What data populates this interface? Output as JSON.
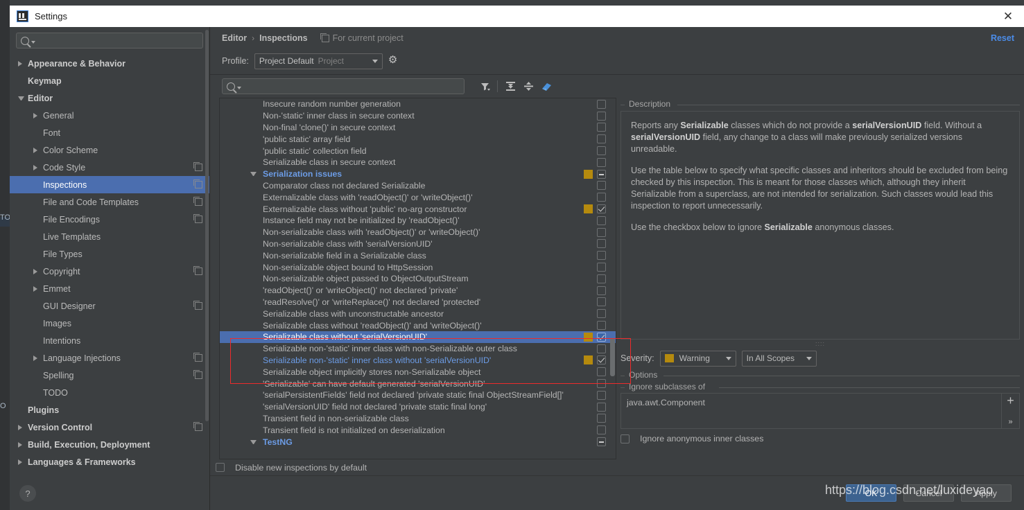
{
  "window": {
    "title": "Settings",
    "close_label": "✕",
    "logo": "intellij-idea-logo"
  },
  "sidebar": {
    "search_placeholder": "",
    "search_value": "",
    "help_label": "?",
    "items": [
      {
        "label": "Appearance & Behavior",
        "arrow": "right",
        "indent": 0,
        "bold": true,
        "copy": false,
        "selected": false
      },
      {
        "label": "Keymap",
        "arrow": "none",
        "indent": 0,
        "bold": true,
        "copy": false,
        "selected": false
      },
      {
        "label": "Editor",
        "arrow": "down",
        "indent": 0,
        "bold": true,
        "copy": false,
        "selected": false
      },
      {
        "label": "General",
        "arrow": "right",
        "indent": 1,
        "bold": false,
        "copy": false,
        "selected": false
      },
      {
        "label": "Font",
        "arrow": "none",
        "indent": 1,
        "bold": false,
        "copy": false,
        "selected": false
      },
      {
        "label": "Color Scheme",
        "arrow": "right",
        "indent": 1,
        "bold": false,
        "copy": false,
        "selected": false
      },
      {
        "label": "Code Style",
        "arrow": "right",
        "indent": 1,
        "bold": false,
        "copy": true,
        "selected": false
      },
      {
        "label": "Inspections",
        "arrow": "none",
        "indent": 1,
        "bold": false,
        "copy": true,
        "selected": true
      },
      {
        "label": "File and Code Templates",
        "arrow": "none",
        "indent": 1,
        "bold": false,
        "copy": true,
        "selected": false
      },
      {
        "label": "File Encodings",
        "arrow": "none",
        "indent": 1,
        "bold": false,
        "copy": true,
        "selected": false
      },
      {
        "label": "Live Templates",
        "arrow": "none",
        "indent": 1,
        "bold": false,
        "copy": false,
        "selected": false
      },
      {
        "label": "File Types",
        "arrow": "none",
        "indent": 1,
        "bold": false,
        "copy": false,
        "selected": false
      },
      {
        "label": "Copyright",
        "arrow": "right",
        "indent": 1,
        "bold": false,
        "copy": true,
        "selected": false
      },
      {
        "label": "Emmet",
        "arrow": "right",
        "indent": 1,
        "bold": false,
        "copy": false,
        "selected": false
      },
      {
        "label": "GUI Designer",
        "arrow": "none",
        "indent": 1,
        "bold": false,
        "copy": true,
        "selected": false
      },
      {
        "label": "Images",
        "arrow": "none",
        "indent": 1,
        "bold": false,
        "copy": false,
        "selected": false
      },
      {
        "label": "Intentions",
        "arrow": "none",
        "indent": 1,
        "bold": false,
        "copy": false,
        "selected": false
      },
      {
        "label": "Language Injections",
        "arrow": "right",
        "indent": 1,
        "bold": false,
        "copy": true,
        "selected": false
      },
      {
        "label": "Spelling",
        "arrow": "none",
        "indent": 1,
        "bold": false,
        "copy": true,
        "selected": false
      },
      {
        "label": "TODO",
        "arrow": "none",
        "indent": 1,
        "bold": false,
        "copy": false,
        "selected": false
      },
      {
        "label": "Plugins",
        "arrow": "none",
        "indent": 0,
        "bold": true,
        "copy": false,
        "selected": false
      },
      {
        "label": "Version Control",
        "arrow": "right",
        "indent": 0,
        "bold": true,
        "copy": true,
        "selected": false
      },
      {
        "label": "Build, Execution, Deployment",
        "arrow": "right",
        "indent": 0,
        "bold": true,
        "copy": false,
        "selected": false
      },
      {
        "label": "Languages & Frameworks",
        "arrow": "right",
        "indent": 0,
        "bold": true,
        "copy": false,
        "selected": false
      }
    ]
  },
  "header": {
    "breadcrumb_root": "Editor",
    "breadcrumb_sep": "›",
    "breadcrumb_current": "Inspections",
    "for_current_project": "For current project",
    "reset_label": "Reset"
  },
  "profile": {
    "label": "Profile:",
    "value": "Project Default",
    "scope": "Project",
    "gear_icon": "gear-icon"
  },
  "toolbar": {
    "search_value": "",
    "search_placeholder": "",
    "filter_icon": "filter-funnel-icon",
    "expand_icon": "expand-all-icon",
    "collapse_icon": "collapse-all-icon",
    "reset_to_empty_icon": "eraser-icon"
  },
  "inspections": {
    "rows": [
      {
        "label": "Insecure random number generation",
        "group": false,
        "severity": null,
        "check": "off",
        "selected": false,
        "blue": false
      },
      {
        "label": "Non-'static' inner class in secure context",
        "group": false,
        "severity": null,
        "check": "off",
        "selected": false,
        "blue": false
      },
      {
        "label": "Non-final 'clone()' in secure context",
        "group": false,
        "severity": null,
        "check": "off",
        "selected": false,
        "blue": false
      },
      {
        "label": "'public static' array field",
        "group": false,
        "severity": null,
        "check": "off",
        "selected": false,
        "blue": false
      },
      {
        "label": "'public static' collection field",
        "group": false,
        "severity": null,
        "check": "off",
        "selected": false,
        "blue": false
      },
      {
        "label": "Serializable class in secure context",
        "group": false,
        "severity": null,
        "check": "off",
        "selected": false,
        "blue": false
      },
      {
        "label": "Serialization issues",
        "group": true,
        "severity": "#b58a0e",
        "check": "tri",
        "selected": false,
        "blue": false
      },
      {
        "label": "Comparator class not declared Serializable",
        "group": false,
        "severity": null,
        "check": "off",
        "selected": false,
        "blue": false
      },
      {
        "label": "Externalizable class with 'readObject()' or 'writeObject()'",
        "group": false,
        "severity": null,
        "check": "off",
        "selected": false,
        "blue": false
      },
      {
        "label": "Externalizable class without 'public' no-arg constructor",
        "group": false,
        "severity": "#b58a0e",
        "check": "on",
        "selected": false,
        "blue": false
      },
      {
        "label": "Instance field may not be initialized by 'readObject()'",
        "group": false,
        "severity": null,
        "check": "off",
        "selected": false,
        "blue": false
      },
      {
        "label": "Non-serializable class with 'readObject()' or 'writeObject()'",
        "group": false,
        "severity": null,
        "check": "off",
        "selected": false,
        "blue": false
      },
      {
        "label": "Non-serializable class with 'serialVersionUID'",
        "group": false,
        "severity": null,
        "check": "off",
        "selected": false,
        "blue": false
      },
      {
        "label": "Non-serializable field in a Serializable class",
        "group": false,
        "severity": null,
        "check": "off",
        "selected": false,
        "blue": false
      },
      {
        "label": "Non-serializable object bound to HttpSession",
        "group": false,
        "severity": null,
        "check": "off",
        "selected": false,
        "blue": false
      },
      {
        "label": "Non-serializable object passed to ObjectOutputStream",
        "group": false,
        "severity": null,
        "check": "off",
        "selected": false,
        "blue": false
      },
      {
        "label": "'readObject()' or 'writeObject()' not declared 'private'",
        "group": false,
        "severity": null,
        "check": "off",
        "selected": false,
        "blue": false
      },
      {
        "label": "'readResolve()' or 'writeReplace()' not declared 'protected'",
        "group": false,
        "severity": null,
        "check": "off",
        "selected": false,
        "blue": false
      },
      {
        "label": "Serializable class with unconstructable ancestor",
        "group": false,
        "severity": null,
        "check": "off",
        "selected": false,
        "blue": false
      },
      {
        "label": "Serializable class without 'readObject()' and 'writeObject()'",
        "group": false,
        "severity": null,
        "check": "off",
        "selected": false,
        "blue": false
      },
      {
        "label": "Serializable class without 'serialVersionUID'",
        "group": false,
        "severity": "#b58a0e",
        "check": "on",
        "selected": true,
        "blue": false
      },
      {
        "label": "Serializable non-'static' inner class with non-Serializable outer class",
        "group": false,
        "severity": null,
        "check": "off",
        "selected": false,
        "blue": false
      },
      {
        "label": "Serializable non-'static' inner class without 'serialVersionUID'",
        "group": false,
        "severity": "#b58a0e",
        "check": "on",
        "selected": false,
        "blue": true
      },
      {
        "label": "Serializable object implicitly stores non-Serializable object",
        "group": false,
        "severity": null,
        "check": "off",
        "selected": false,
        "blue": false
      },
      {
        "label": "'Serializable' can have default generated 'serialVersionUID'",
        "group": false,
        "severity": null,
        "check": "off",
        "selected": false,
        "blue": false
      },
      {
        "label": "'serialPersistentFields' field not declared 'private static final ObjectStreamField[]'",
        "group": false,
        "severity": null,
        "check": "off",
        "selected": false,
        "blue": false
      },
      {
        "label": "'serialVersionUID' field not declared 'private static final long'",
        "group": false,
        "severity": null,
        "check": "off",
        "selected": false,
        "blue": false
      },
      {
        "label": "Transient field in non-serializable class",
        "group": false,
        "severity": null,
        "check": "off",
        "selected": false,
        "blue": false
      },
      {
        "label": "Transient field is not initialized on deserialization",
        "group": false,
        "severity": null,
        "check": "off",
        "selected": false,
        "blue": false
      },
      {
        "label": "TestNG",
        "group": true,
        "severity": null,
        "check": "tri",
        "selected": false,
        "blue": false
      }
    ],
    "disable_new_label": "Disable new inspections by default",
    "disable_new_checked": false
  },
  "description": {
    "caption": "Description",
    "paragraphs": [
      "Reports any <b>Serializable</b> classes which do not provide a <b>serialVersionUID</b> field. Without a <b>serialVersionUID</b> field, any change to a class will make previously serialized versions unreadable.",
      "Use the table below to specify what specific classes and inheritors should be excluded from being checked by this inspection. This is meant for those classes which, although they inherit Serializable from a superclass, are not intended for serialization. Such classes would lead this inspection to report unnecessarily.",
      "Use the checkbox below to ignore <b>Serializable</b> anonymous classes."
    ]
  },
  "severity": {
    "label": "Severity:",
    "value": "Warning",
    "color": "#b58a0e",
    "scope": "In All Scopes"
  },
  "options": {
    "caption": "Options",
    "ignore_subclasses_caption": "Ignore subclasses of",
    "ignore_subclasses_items": [
      "java.awt.Component"
    ],
    "add_label": "+",
    "more_label": "»",
    "ignore_anonymous_label": "Ignore anonymous inner classes",
    "ignore_anonymous_checked": false
  },
  "buttons": {
    "ok": "OK",
    "cancel": "Cancel",
    "apply": "Apply"
  },
  "watermark": {
    "text": "https://blog.csdn.net/luxideyao"
  },
  "background": {
    "labels": [
      "TO",
      "O"
    ]
  }
}
